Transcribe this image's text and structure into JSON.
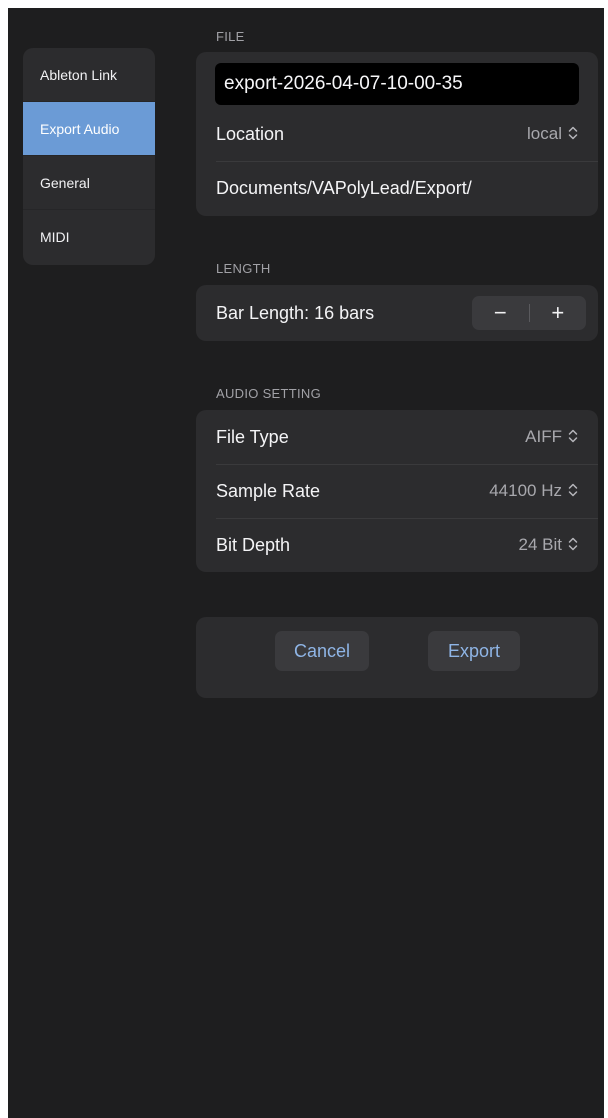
{
  "sidebar": {
    "items": [
      {
        "label": "Ableton Link",
        "active": false
      },
      {
        "label": "Export Audio",
        "active": true
      },
      {
        "label": "General",
        "active": false
      },
      {
        "label": "MIDI",
        "active": false
      }
    ]
  },
  "file": {
    "header": "FILE",
    "filename": "export-2026-04-07-10-00-35",
    "location_label": "Location",
    "location_value": "local",
    "path": "Documents/VAPolyLead/Export/"
  },
  "length": {
    "header": "LENGTH",
    "label": "Bar Length: 16 bars",
    "decrement": "−",
    "increment": "+"
  },
  "audio": {
    "header": "AUDIO SETTING",
    "file_type_label": "File Type",
    "file_type_value": "AIFF",
    "sample_rate_label": "Sample Rate",
    "sample_rate_value": "44100 Hz",
    "bit_depth_label": "Bit Depth",
    "bit_depth_value": "24 Bit"
  },
  "actions": {
    "cancel_label": "Cancel",
    "export_label": "Export"
  },
  "icons": {
    "updown_chevron": "up-down-chevron-icon"
  },
  "colors": {
    "accent": "#6b9bd6",
    "background": "#1e1e1f",
    "panel": "#2c2c2e",
    "button_text": "#8fb5e6"
  }
}
